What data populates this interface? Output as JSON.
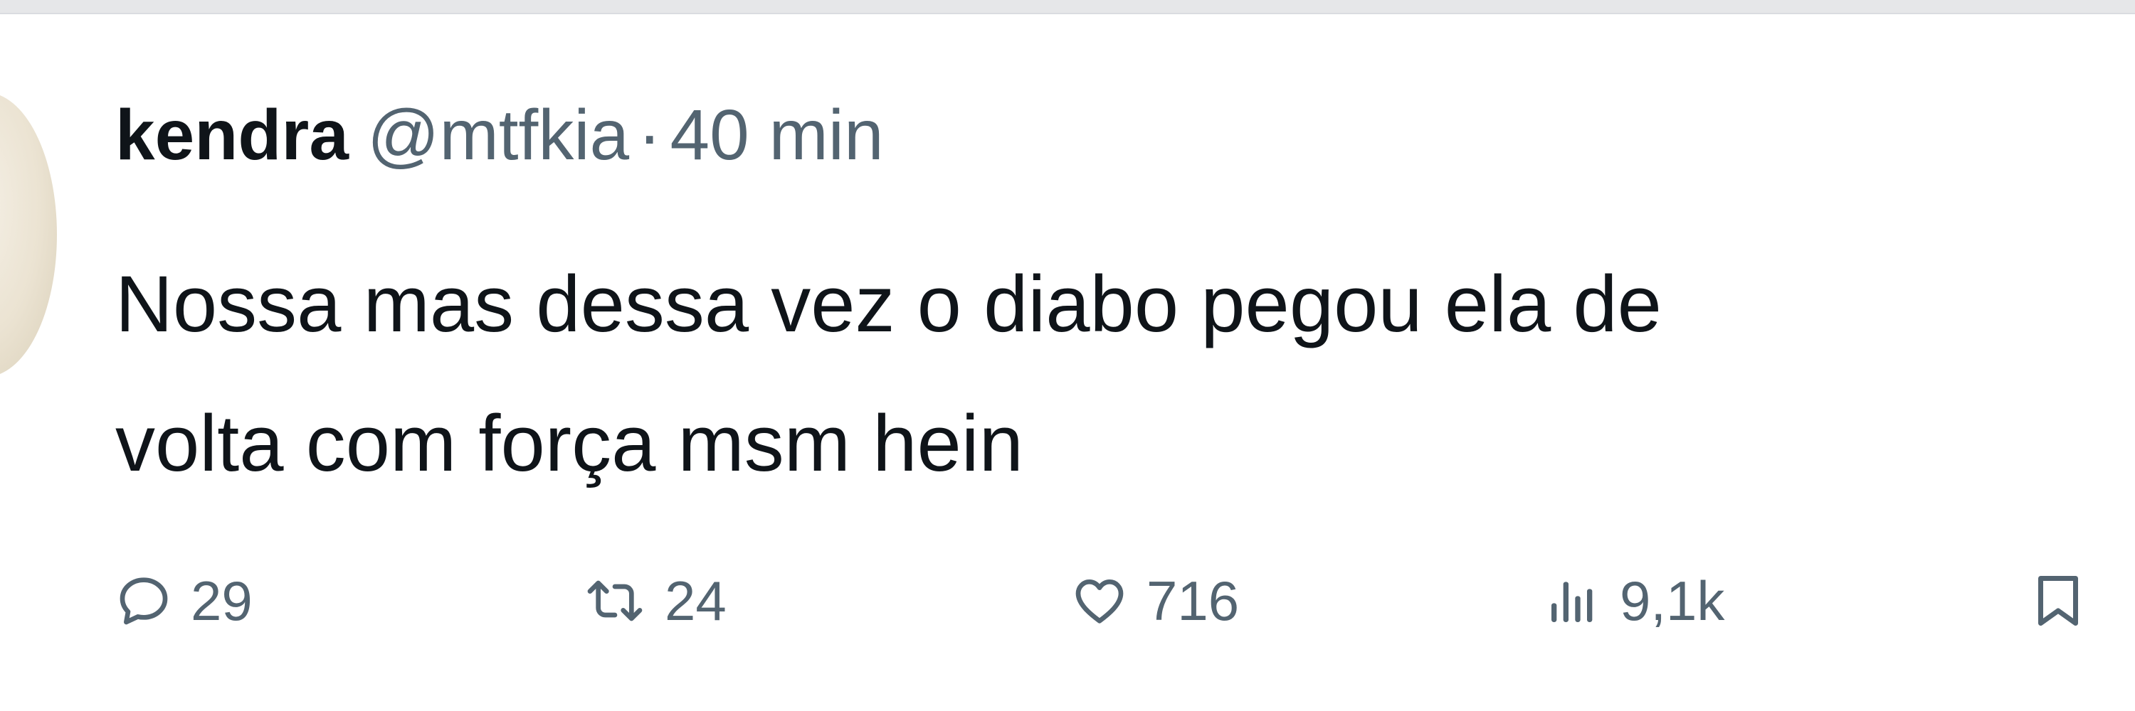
{
  "tweet": {
    "display_name": "kendra",
    "handle": "@mtfkia",
    "separator": "·",
    "time": "40 min",
    "text_line_1": "Nossa mas dessa vez o diabo pegou ela de",
    "text_line_2": "volta com força msm hein"
  },
  "actions": {
    "replies": "29",
    "retweets": "24",
    "likes": "716",
    "views": "9,1k"
  },
  "icons": {
    "reply": "reply-bubble-icon",
    "retweet": "retweet-icon",
    "like": "heart-icon",
    "views": "views-bar-chart-icon",
    "bookmark": "bookmark-icon"
  },
  "colors": {
    "text_primary": "#0f1419",
    "text_secondary": "#536471",
    "background": "#ffffff"
  }
}
